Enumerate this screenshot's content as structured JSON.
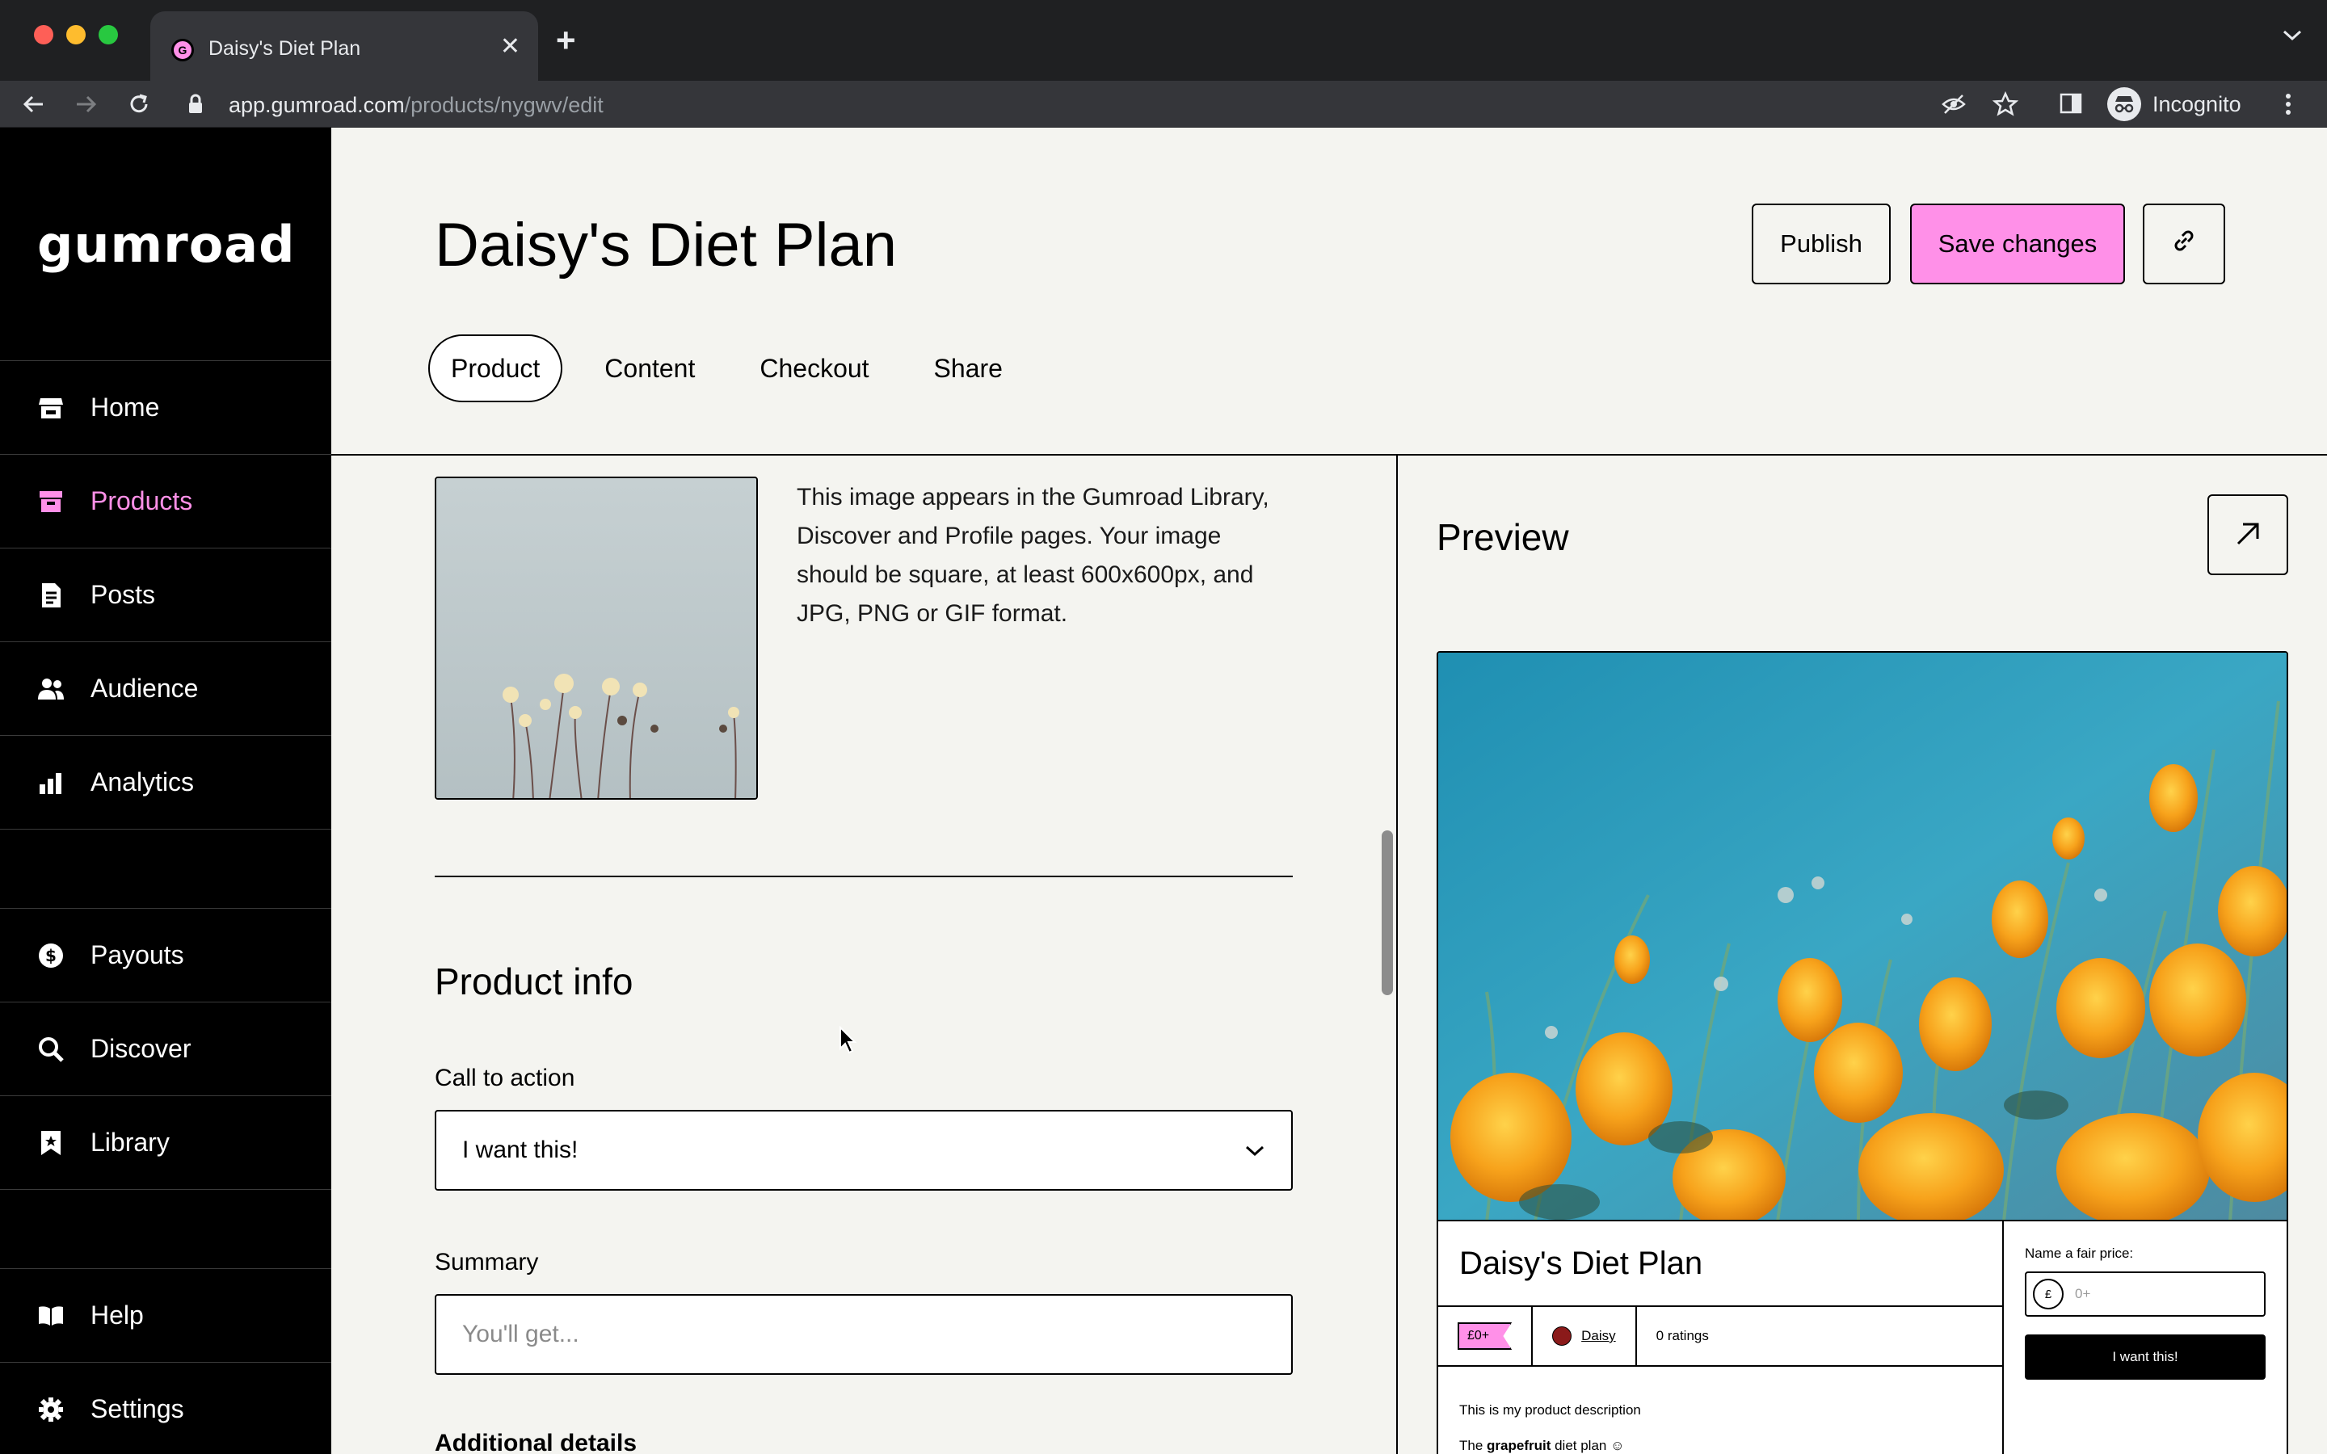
{
  "browser": {
    "tab_title": "Daisy's Diet Plan",
    "url_host": "app.gumroad.com",
    "url_path": "/products/nygwv/edit",
    "profile_label": "Incognito"
  },
  "sidebar": {
    "logo": "Gumroad",
    "items": [
      {
        "label": "Home",
        "icon": "home-icon"
      },
      {
        "label": "Products",
        "icon": "products-icon",
        "active": true
      },
      {
        "label": "Posts",
        "icon": "posts-icon"
      },
      {
        "label": "Audience",
        "icon": "audience-icon"
      },
      {
        "label": "Analytics",
        "icon": "analytics-icon"
      },
      {
        "label": "Payouts",
        "icon": "payouts-icon"
      },
      {
        "label": "Discover",
        "icon": "search-icon"
      },
      {
        "label": "Library",
        "icon": "library-icon"
      },
      {
        "label": "Help",
        "icon": "help-icon"
      },
      {
        "label": "Settings",
        "icon": "gear-icon"
      }
    ]
  },
  "header": {
    "title": "Daisy's Diet Plan",
    "publish_label": "Publish",
    "save_label": "Save changes",
    "tabs": [
      "Product",
      "Content",
      "Checkout",
      "Share"
    ],
    "active_tab": "Product"
  },
  "editor": {
    "thumbnail_help": "This image appears in the Gumroad Library, Discover and Profile pages. Your image should be square, at least 600x600px, and JPG, PNG or GIF format.",
    "section_title": "Product info",
    "cta_label": "Call to action",
    "cta_value": "I want this!",
    "summary_label": "Summary",
    "summary_placeholder": "You'll get...",
    "additional_details_label": "Additional details"
  },
  "preview": {
    "title": "Preview",
    "product_name": "Daisy's Diet Plan",
    "price": "£0+",
    "creator": "Daisy",
    "ratings": "0 ratings",
    "description_1": "This is my product description",
    "description_2_prefix": "The ",
    "description_2_bold": "grapefruit",
    "description_2_suffix": " diet plan ☺",
    "fair_price_label": "Name a fair price:",
    "currency_symbol": "£",
    "fair_price_placeholder": "0+",
    "cta_button": "I want this!"
  },
  "colors": {
    "brand_pink": "#ff90e8",
    "sidebar_bg": "#000000",
    "page_bg": "#f4f4f0"
  }
}
